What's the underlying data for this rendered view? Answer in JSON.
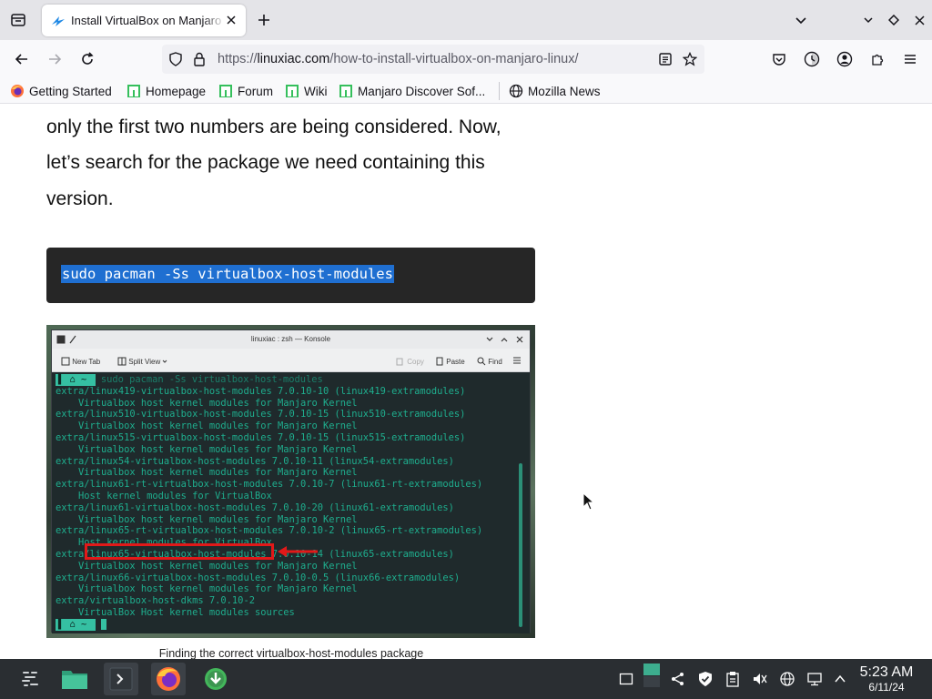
{
  "browser": {
    "tab": {
      "title": "Install VirtualBox on Manjaro Linux"
    },
    "url": {
      "scheme": "https://",
      "domain": "linuxiac.com",
      "path": "/how-to-install-virtualbox-on-manjaro-linux/"
    },
    "bookmarks": [
      {
        "label": "Getting Started",
        "icon": "firefox-icon"
      },
      {
        "label": "Homepage",
        "icon": "manjaro-icon"
      },
      {
        "label": "Forum",
        "icon": "manjaro-icon"
      },
      {
        "label": "Wiki",
        "icon": "manjaro-icon"
      },
      {
        "label": "Manjaro Discover Sof...",
        "icon": "manjaro-icon"
      },
      {
        "label": "Mozilla News",
        "icon": "globe-icon"
      }
    ]
  },
  "article": {
    "lines": [
      "only the first two numbers are being considered. Now,",
      "let’s search for the package we need containing this",
      "version."
    ],
    "code": "sudo pacman -Ss virtualbox-host-modules",
    "caption": "Finding the correct virtualbox-host-modules package"
  },
  "terminal": {
    "window_title": "linuxiac : zsh — Konsole",
    "toolbar": {
      "new_tab": "New Tab",
      "split_view": "Split View",
      "copy": "Copy",
      "paste": "Paste",
      "find": "Find"
    },
    "command": "sudo pacman -Ss virtualbox-host-modules",
    "output": [
      "extra/linux419-virtualbox-host-modules 7.0.10-10 (linux419-extramodules)",
      "    Virtualbox host kernel modules for Manjaro Kernel",
      "extra/linux510-virtualbox-host-modules 7.0.10-15 (linux510-extramodules)",
      "    Virtualbox host kernel modules for Manjaro Kernel",
      "extra/linux515-virtualbox-host-modules 7.0.10-15 (linux515-extramodules)",
      "    Virtualbox host kernel modules for Manjaro Kernel",
      "extra/linux54-virtualbox-host-modules 7.0.10-11 (linux54-extramodules)",
      "    Virtualbox host kernel modules for Manjaro Kernel",
      "extra/linux61-rt-virtualbox-host-modules 7.0.10-7 (linux61-rt-extramodules)",
      "    Host kernel modules for VirtualBox",
      "extra/linux61-virtualbox-host-modules 7.0.10-20 (linux61-extramodules)",
      "    Virtualbox host kernel modules for Manjaro Kernel",
      "extra/linux65-rt-virtualbox-host-modules 7.0.10-2 (linux65-rt-extramodules)",
      "    Host kernel modules for VirtualBox",
      "extra/linux65-virtualbox-host-modules 7.0.10-14 (linux65-extramodules)",
      "    Virtualbox host kernel modules for Manjaro Kernel",
      "extra/linux66-virtualbox-host-modules 7.0.10-0.5 (linux66-extramodules)",
      "    Virtualbox host kernel modules for Manjaro Kernel",
      "extra/virtualbox-host-dkms 7.0.10-2",
      "    VirtualBox Host kernel modules sources"
    ]
  },
  "taskbar": {
    "time": "5:23 AM",
    "date": "6/11/24"
  },
  "colors": {
    "accent": "#1f6fd1",
    "terminal_text": "#1fae8e",
    "highlight": "#e11919",
    "taskbar": "#2a2e32"
  }
}
